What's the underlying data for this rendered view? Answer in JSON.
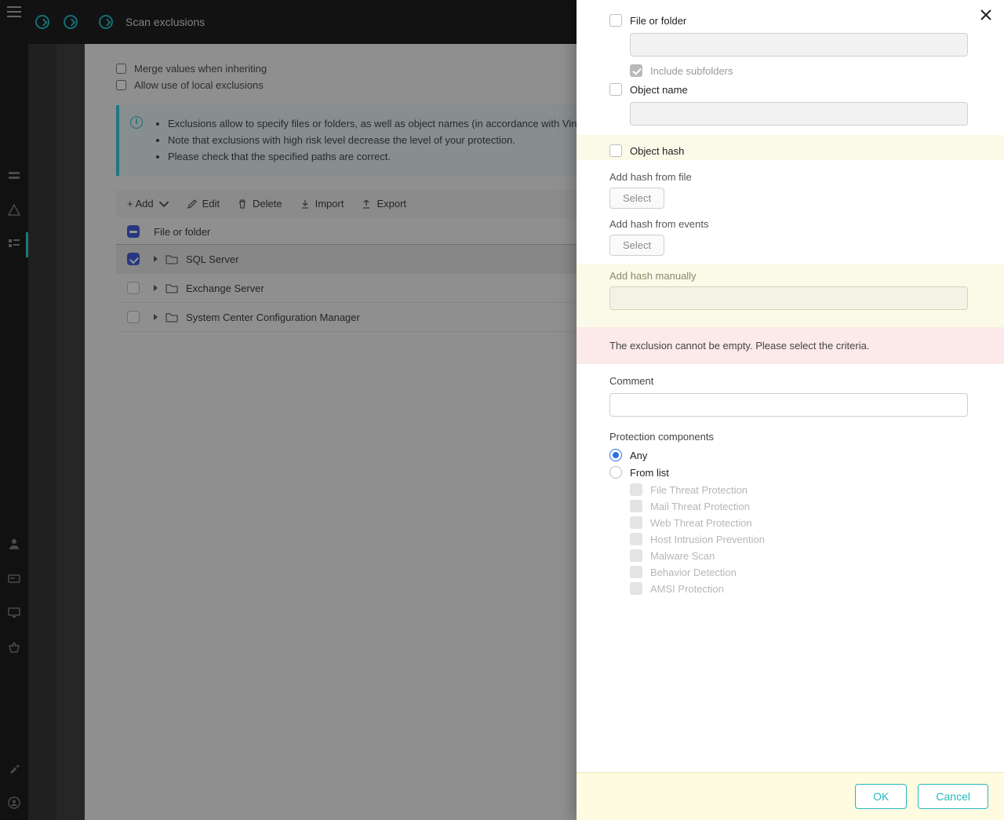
{
  "header": {
    "title": "Scan exclusions"
  },
  "options": {
    "merge": "Merge values when inheriting",
    "allow_local": "Allow use of local exclusions"
  },
  "info": {
    "line1": "Exclusions allow to specify files or folders, as well as object names (in accordance with Virus Encyclopedia classification), which will be skipped by application components.",
    "line2": "Note that exclusions with high risk level decrease the level of your protection.",
    "line3": "Please check that the specified paths are correct."
  },
  "toolbar": {
    "add": "+ Add",
    "edit": "Edit",
    "delete": "Delete",
    "import": "Import",
    "export": "Export"
  },
  "table": {
    "col1": "File or folder",
    "rows": [
      {
        "name": "SQL Server",
        "checked": true,
        "selected": true
      },
      {
        "name": "Exchange Server",
        "checked": false,
        "selected": false
      },
      {
        "name": "System Center Configuration Manager",
        "checked": false,
        "selected": false
      }
    ]
  },
  "panel": {
    "file_or_folder": "File or folder",
    "include_subfolders": "Include subfolders",
    "object_name": "Object name",
    "object_hash": "Object hash",
    "add_hash_file": "Add hash from file",
    "add_hash_events": "Add hash from events",
    "add_hash_manual": "Add hash manually",
    "select": "Select",
    "error": "The exclusion cannot be empty. Please select the criteria.",
    "comment": "Comment",
    "protection_components": "Protection components",
    "radio_any": "Any",
    "radio_fromlist": "From list",
    "components": [
      "File Threat Protection",
      "Mail Threat Protection",
      "Web Threat Protection",
      "Host Intrusion Prevention",
      "Malware Scan",
      "Behavior Detection",
      "AMSI Protection"
    ],
    "ok": "OK",
    "cancel": "Cancel"
  }
}
